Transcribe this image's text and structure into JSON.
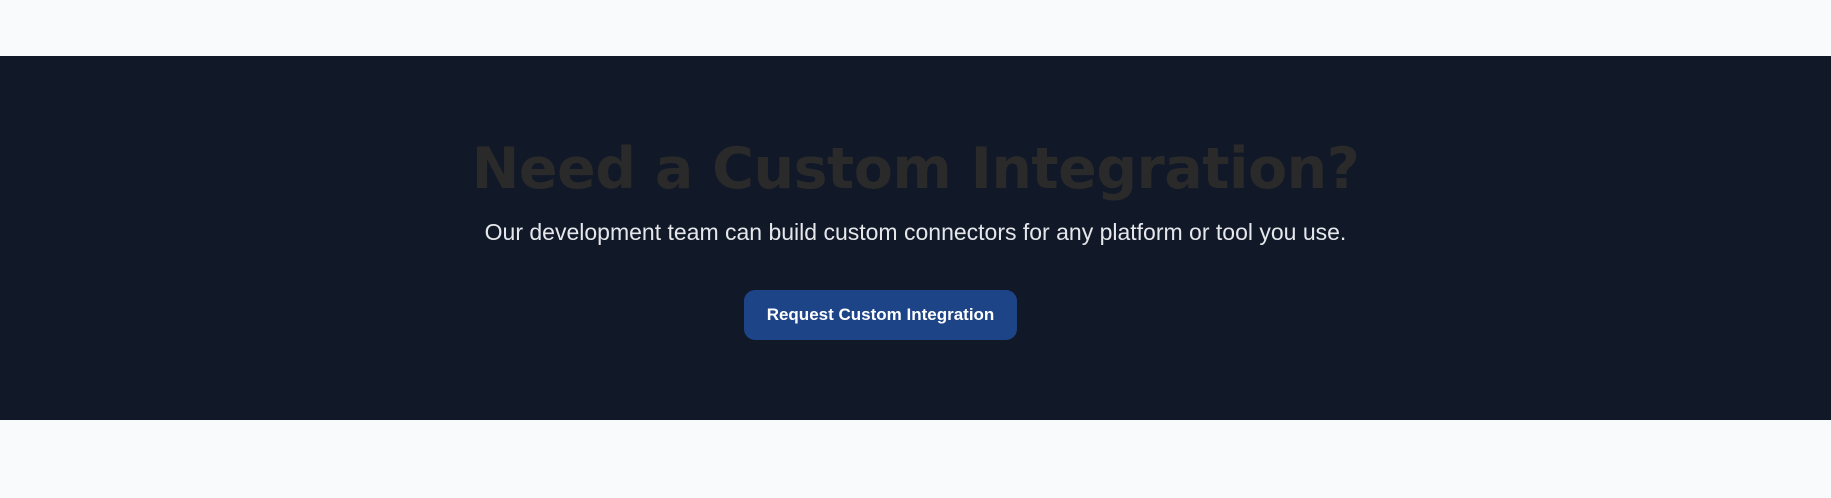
{
  "cta": {
    "title": "Need a Custom Integration?",
    "subtitle": "Our development team can build custom connectors for any platform or tool you use.",
    "button_label": "Request Custom Integration"
  },
  "colors": {
    "page_background": "#f8fafc",
    "section_background": "#111827",
    "title_text": "#2a2a2a",
    "subtitle_text": "#e5e7eb",
    "button_background": "#1e4488",
    "button_text": "#ffffff"
  }
}
